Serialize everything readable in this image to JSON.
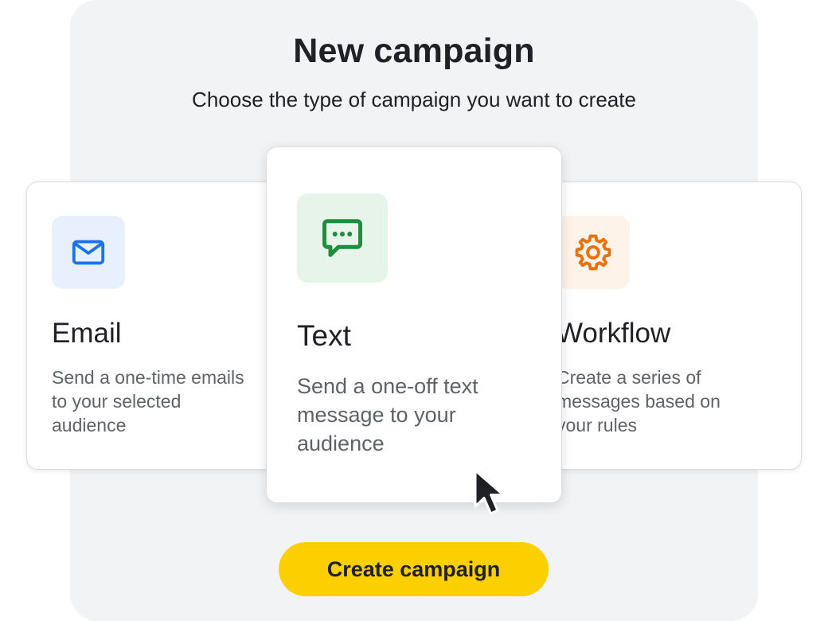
{
  "header": {
    "title": "New campaign",
    "subtitle": "Choose the type of campaign you want to create"
  },
  "campaign_types": [
    {
      "title": "Email",
      "description": "Send a one-time emails to your selected audience",
      "icon": "envelope-icon",
      "icon_color": "#1a73e8",
      "tile_color": "#e8f0fe",
      "selected": false
    },
    {
      "title": "Text",
      "description": "Send a one-off text message to your audience",
      "icon": "chat-bubble-icon",
      "icon_color": "#1e8e3e",
      "tile_color": "#e6f4ea",
      "selected": true
    },
    {
      "title": "Workflow",
      "description": "Create a series of messages based on your rules",
      "icon": "gear-icon",
      "icon_color": "#e8710a",
      "tile_color": "#fef3e8",
      "selected": false
    }
  ],
  "cta": {
    "label": "Create campaign",
    "color": "#fcd000"
  },
  "colors": {
    "panel_background": "#f1f3f4",
    "text_primary": "#202124",
    "text_secondary": "#5f6368"
  }
}
